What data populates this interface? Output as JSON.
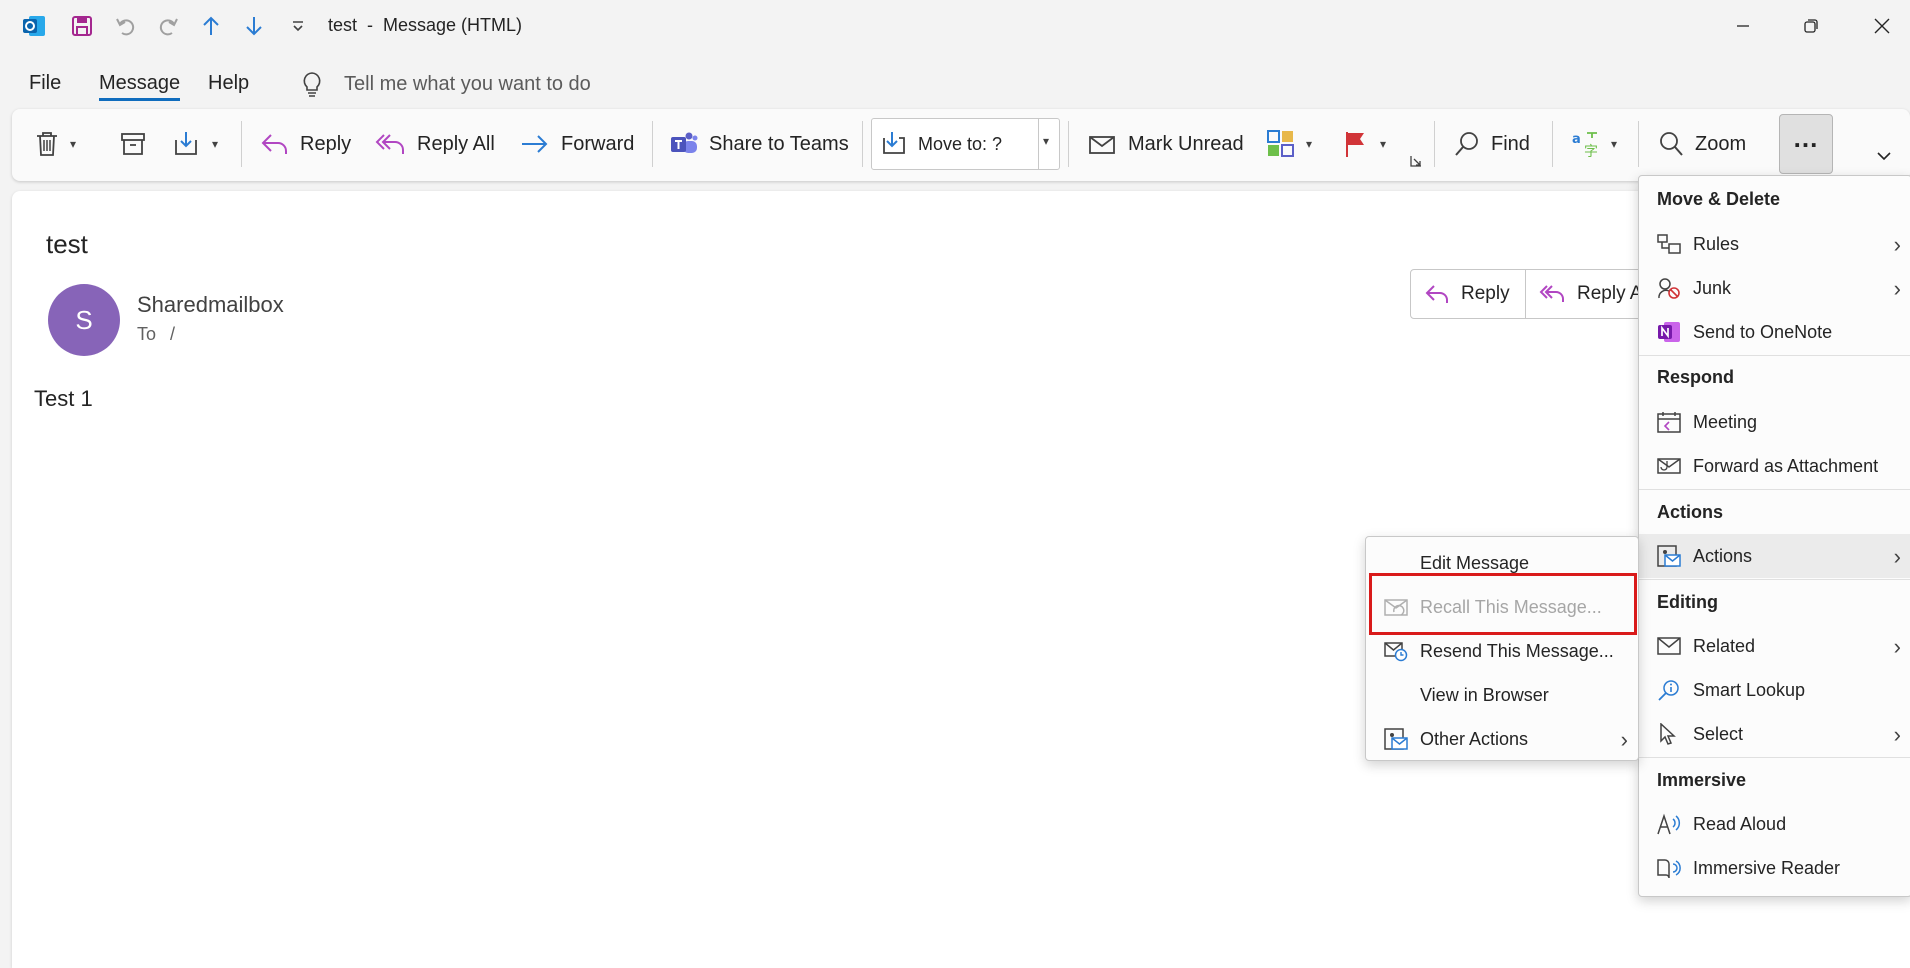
{
  "window": {
    "title": "test  -  Message (HTML)"
  },
  "quick_access": {
    "icons": [
      "outlook-app-icon",
      "save-icon",
      "undo-icon",
      "redo-icon",
      "previous-item-icon",
      "next-item-icon",
      "customize-dropdown-icon"
    ]
  },
  "tabs": [
    {
      "label": "File"
    },
    {
      "label": "Message",
      "active": true
    },
    {
      "label": "Help"
    }
  ],
  "tell_me": {
    "placeholder": "Tell me what you want to do"
  },
  "ribbon": {
    "reply": "Reply",
    "reply_all": "Reply All",
    "forward": "Forward",
    "share_to_teams": "Share to Teams",
    "move_to": "Move to: ?",
    "mark_unread": "Mark Unread",
    "find": "Find",
    "zoom": "Zoom",
    "more": "..."
  },
  "message": {
    "subject": "test",
    "avatar_initial": "S",
    "sender": "Sharedmailbox",
    "to_label": "To",
    "to_value": "/",
    "body": "Test 1",
    "reply_button": "Reply",
    "reply_all_button": "Reply A"
  },
  "overflow_menu": {
    "sections": [
      {
        "header": "Move & Delete",
        "items": [
          {
            "label": "Rules",
            "icon": "rules-icon",
            "submenu": true
          },
          {
            "label": "Junk",
            "icon": "junk-icon",
            "submenu": true
          },
          {
            "label": "Send to OneNote",
            "icon": "onenote-icon",
            "submenu": false
          }
        ]
      },
      {
        "header": "Respond",
        "items": [
          {
            "label": "Meeting",
            "icon": "meeting-icon",
            "submenu": false
          },
          {
            "label": "Forward as Attachment",
            "icon": "forward-attachment-icon",
            "submenu": false
          }
        ]
      },
      {
        "header": "Actions",
        "items": [
          {
            "label": "Actions",
            "icon": "actions-icon",
            "submenu": true,
            "highlighted": true
          }
        ]
      },
      {
        "header": "Editing",
        "items": [
          {
            "label": "Related",
            "icon": "related-icon",
            "submenu": true
          },
          {
            "label": "Smart Lookup",
            "icon": "smart-lookup-icon",
            "submenu": false
          },
          {
            "label": "Select",
            "icon": "select-icon",
            "submenu": true
          }
        ]
      },
      {
        "header": "Immersive",
        "items": [
          {
            "label": "Read Aloud",
            "icon": "read-aloud-icon",
            "submenu": false
          },
          {
            "label": "Immersive Reader",
            "icon": "immersive-reader-icon",
            "submenu": false
          }
        ]
      }
    ]
  },
  "actions_submenu": {
    "items": [
      {
        "label": "Edit Message",
        "icon": "",
        "disabled": false
      },
      {
        "label": "Recall This Message...",
        "icon": "recall-icon",
        "disabled": true,
        "highlighted_box": true
      },
      {
        "label": "Resend This Message...",
        "icon": "resend-icon",
        "disabled": false
      },
      {
        "label": "View in Browser",
        "icon": "",
        "disabled": false
      },
      {
        "label": "Other Actions",
        "icon": "other-actions-icon",
        "submenu": true
      }
    ]
  },
  "colors": {
    "accent": "#0f6cbd",
    "avatar": "#8764b8",
    "reply_purple": "#b146c2",
    "highlight_box": "#d91a1a"
  }
}
